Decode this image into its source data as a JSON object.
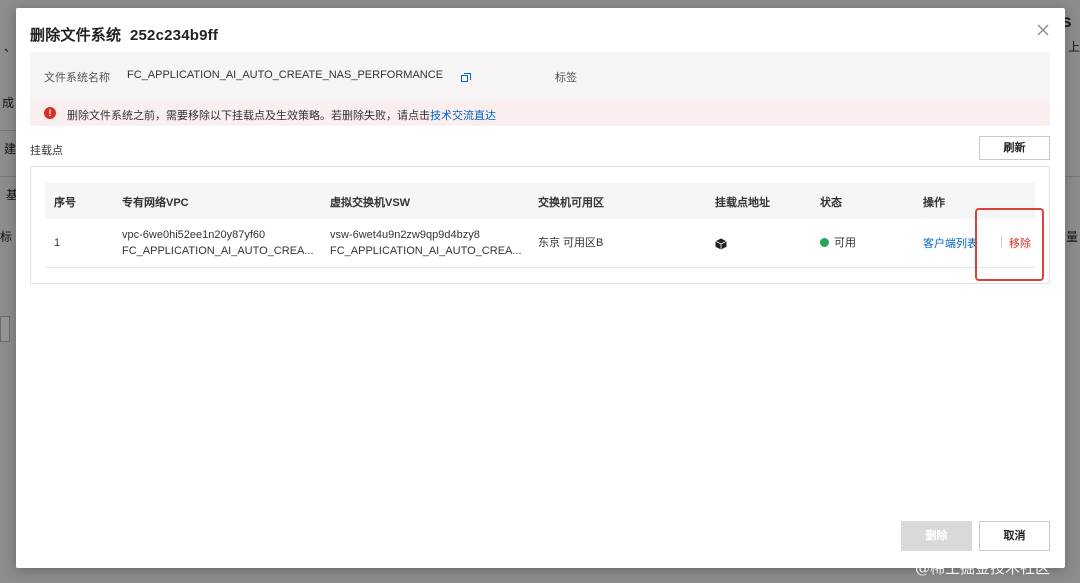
{
  "background": {
    "fragments": [
      "S",
      "上",
      "、",
      "成",
      "建",
      "基",
      "标",
      "量"
    ]
  },
  "modal": {
    "title": "删除文件系统",
    "title_id": "252c234b9ff",
    "info": {
      "fs_name_label": "文件系统名称",
      "fs_name_value": "FC_APPLICATION_AI_AUTO_CREATE_NAS_PERFORMANCE",
      "tag_label": "标签"
    },
    "warning": {
      "text": "删除文件系统之前，需要移除以下挂载点及生效策略。若删除失败，请点击",
      "link": "技术交流直达"
    },
    "section_label": "挂载点",
    "refresh_label": "刷新",
    "table": {
      "headers": [
        "序号",
        "专有网络VPC",
        "虚拟交换机VSW",
        "交换机可用区",
        "挂载点地址",
        "状态",
        "操作"
      ],
      "rows": [
        {
          "index": "1",
          "vpc_id": "vpc-6we0hi52ee1n20y87yf60",
          "vpc_name": "FC_APPLICATION_AI_AUTO_CREA...",
          "vsw_id": "vsw-6wet4u9n2zw9qp9d4bzy8",
          "vsw_name": "FC_APPLICATION_AI_AUTO_CREA...",
          "zone": "东京 可用区B",
          "status": "可用",
          "op_clients": "客户端列表",
          "op_remove": "移除"
        }
      ]
    },
    "footer": {
      "delete_label": "删除",
      "cancel_label": "取消"
    }
  },
  "watermark": "@稀土掘金技术社区",
  "colors": {
    "link": "#0064c8",
    "danger": "#d93026",
    "success": "#26a65b",
    "highlight": "#d9443a"
  }
}
